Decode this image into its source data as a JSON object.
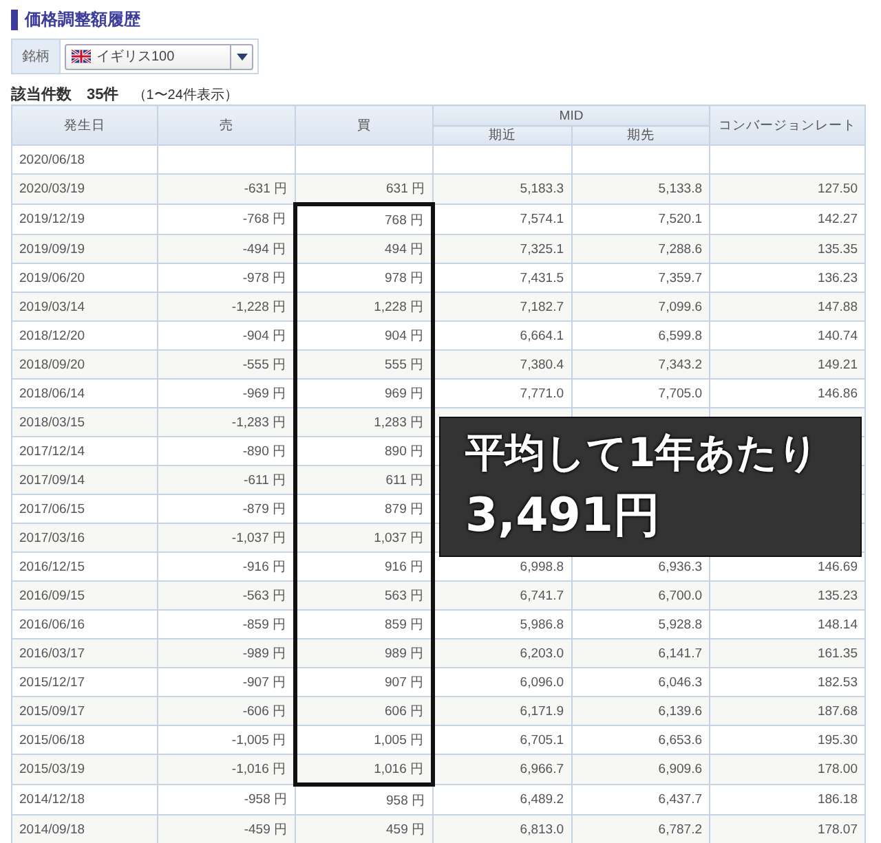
{
  "title": "価格調整額履歴",
  "filter": {
    "label": "銘柄",
    "value": "イギリス100"
  },
  "count": "**該当件数　35件**　（1〜24件表示）",
  "table": {
    "columns": [
      "発生日",
      "売",
      "買",
      "MID",
      "期近",
      "期先",
      "コンバージョンレート"
    ],
    "rows": [
      {
        "date": "2020/06/18",
        "boxed": false
      },
      {
        "date": "2020/03/19",
        "sell": "-631 円",
        "buy": "631 円",
        "near": "5,183.3",
        "far": "5,133.8",
        "rate": "127.50",
        "boxed": false
      },
      {
        "date": "2019/12/19",
        "sell": "-768 円",
        "buy": "768 円",
        "near": "7,574.1",
        "far": "7,520.1",
        "rate": "142.27",
        "boxed": true
      },
      {
        "date": "2019/09/19",
        "sell": "-494 円",
        "buy": "494 円",
        "near": "7,325.1",
        "far": "7,288.6",
        "rate": "135.35",
        "boxed": true
      },
      {
        "date": "2019/06/20",
        "sell": "-978 円",
        "buy": "978 円",
        "near": "7,431.5",
        "far": "7,359.7",
        "rate": "136.23",
        "boxed": true
      },
      {
        "date": "2019/03/14",
        "sell": "-1,228 円",
        "buy": "1,228 円",
        "near": "7,182.7",
        "far": "7,099.6",
        "rate": "147.88",
        "boxed": true
      },
      {
        "date": "2018/12/20",
        "sell": "-904 円",
        "buy": "904 円",
        "near": "6,664.1",
        "far": "6,599.8",
        "rate": "140.74",
        "boxed": true
      },
      {
        "date": "2018/09/20",
        "sell": "-555 円",
        "buy": "555 円",
        "near": "7,380.4",
        "far": "7,343.2",
        "rate": "149.21",
        "boxed": true
      },
      {
        "date": "2018/06/14",
        "sell": "-969 円",
        "buy": "969 円",
        "near": "7,771.0",
        "far": "7,705.0",
        "rate": "146.86",
        "boxed": true
      },
      {
        "date": "2018/03/15",
        "sell": "-1,283 円",
        "buy": "1,283 円",
        "boxed": true
      },
      {
        "date": "2017/12/14",
        "sell": "-890 円",
        "buy": "890 円",
        "boxed": true
      },
      {
        "date": "2017/09/14",
        "sell": "-611 円",
        "buy": "611 円",
        "boxed": true
      },
      {
        "date": "2017/06/15",
        "sell": "-879 円",
        "buy": "879 円",
        "boxed": true
      },
      {
        "date": "2017/03/16",
        "sell": "-1,037 円",
        "buy": "1,037 円",
        "boxed": true
      },
      {
        "date": "2016/12/15",
        "sell": "-916 円",
        "buy": "916 円",
        "near": "6,998.8",
        "far": "6,936.3",
        "rate": "146.69",
        "boxed": true
      },
      {
        "date": "2016/09/15",
        "sell": "-563 円",
        "buy": "563 円",
        "near": "6,741.7",
        "far": "6,700.0",
        "rate": "135.23",
        "boxed": true
      },
      {
        "date": "2016/06/16",
        "sell": "-859 円",
        "buy": "859 円",
        "near": "5,986.8",
        "far": "5,928.8",
        "rate": "148.14",
        "boxed": true
      },
      {
        "date": "2016/03/17",
        "sell": "-989 円",
        "buy": "989 円",
        "near": "6,203.0",
        "far": "6,141.7",
        "rate": "161.35",
        "boxed": true
      },
      {
        "date": "2015/12/17",
        "sell": "-907 円",
        "buy": "907 円",
        "near": "6,096.0",
        "far": "6,046.3",
        "rate": "182.53",
        "boxed": true
      },
      {
        "date": "2015/09/17",
        "sell": "-606 円",
        "buy": "606 円",
        "near": "6,171.9",
        "far": "6,139.6",
        "rate": "187.68",
        "boxed": true
      },
      {
        "date": "2015/06/18",
        "sell": "-1,005 円",
        "buy": "1,005 円",
        "near": "6,705.1",
        "far": "6,653.6",
        "rate": "195.30",
        "boxed": true
      },
      {
        "date": "2015/03/19",
        "sell": "-1,016 円",
        "buy": "1,016 円",
        "near": "6,966.7",
        "far": "6,909.6",
        "rate": "178.00",
        "boxed": true
      },
      {
        "date": "2014/12/18",
        "sell": "-958 円",
        "buy": "958 円",
        "near": "6,489.2",
        "far": "6,437.7",
        "rate": "186.18",
        "boxed": false
      },
      {
        "date": "2014/09/18",
        "sell": "-459 円",
        "buy": "459 円",
        "near": "6,813.0",
        "far": "6,787.2",
        "rate": "178.07",
        "boxed": false
      }
    ]
  },
  "callout": {
    "line_1": "平均して1年あたり",
    "line_2": "3,491円"
  }
}
